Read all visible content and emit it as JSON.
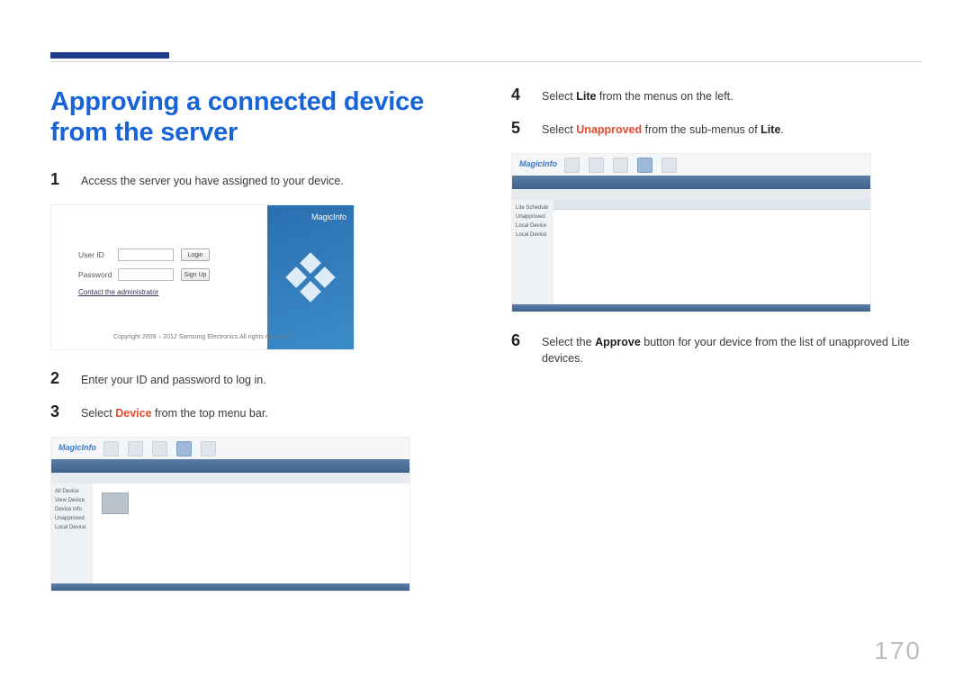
{
  "page_number": "170",
  "heading": "Approving a connected device from the server",
  "left_steps": [
    {
      "n": "1",
      "parts": [
        {
          "t": "Access the server you have assigned to your device."
        }
      ]
    },
    {
      "n": "2",
      "parts": [
        {
          "t": "Enter your ID and password to log in."
        }
      ]
    },
    {
      "n": "3",
      "parts": [
        {
          "t": "Select "
        },
        {
          "t": "Device",
          "cls": "kw-hl"
        },
        {
          "t": " from the top menu bar."
        }
      ]
    }
  ],
  "right_steps": [
    {
      "n": "4",
      "parts": [
        {
          "t": "Select "
        },
        {
          "t": "Lite",
          "cls": "kw-bold"
        },
        {
          "t": " from the menus on the left."
        }
      ]
    },
    {
      "n": "5",
      "parts": [
        {
          "t": "Select "
        },
        {
          "t": "Unapproved",
          "cls": "kw-hl"
        },
        {
          "t": " from the sub-menus of "
        },
        {
          "t": "Lite",
          "cls": "kw-bold"
        },
        {
          "t": "."
        }
      ]
    },
    {
      "n": "6",
      "parts": [
        {
          "t": "Select the "
        },
        {
          "t": "Approve",
          "cls": "kw-bold"
        },
        {
          "t": " button for your device from the list of unapproved Lite devices."
        }
      ]
    }
  ],
  "login_screenshot": {
    "user_id_label": "User ID",
    "password_label": "Password",
    "login_btn": "Login",
    "signup_btn": "Sign Up",
    "admin_link": "Contact the administrator",
    "brand": "MagicInfo",
    "copyright": "Copyright 2009 – 2012 Samsung Electronics All rights reserved."
  },
  "app_screenshot": {
    "brand": "MagicInfo",
    "sidebar_items_a": [
      "All Device",
      "View Device",
      "Device Info",
      "Unapproved",
      "Local Device"
    ],
    "sidebar_items_b": [
      "Lite Schedule",
      "Unapproved",
      "Local Device",
      "Local Device"
    ]
  }
}
